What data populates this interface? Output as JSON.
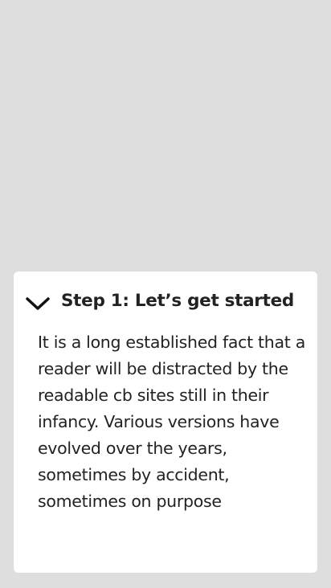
{
  "colors": {
    "background": "#dedede",
    "card": "#ffffff",
    "text": "#222222"
  },
  "accordion": {
    "expanded": true,
    "toggle_icon": "chevron-down-icon",
    "title": "Step 1: Let’s get started",
    "body": "It is a long established fact that a reader will be distracted by the readable cb sites still in their infancy. Various versions have evolved over the years, sometimes by accident, sometimes on purpose"
  }
}
